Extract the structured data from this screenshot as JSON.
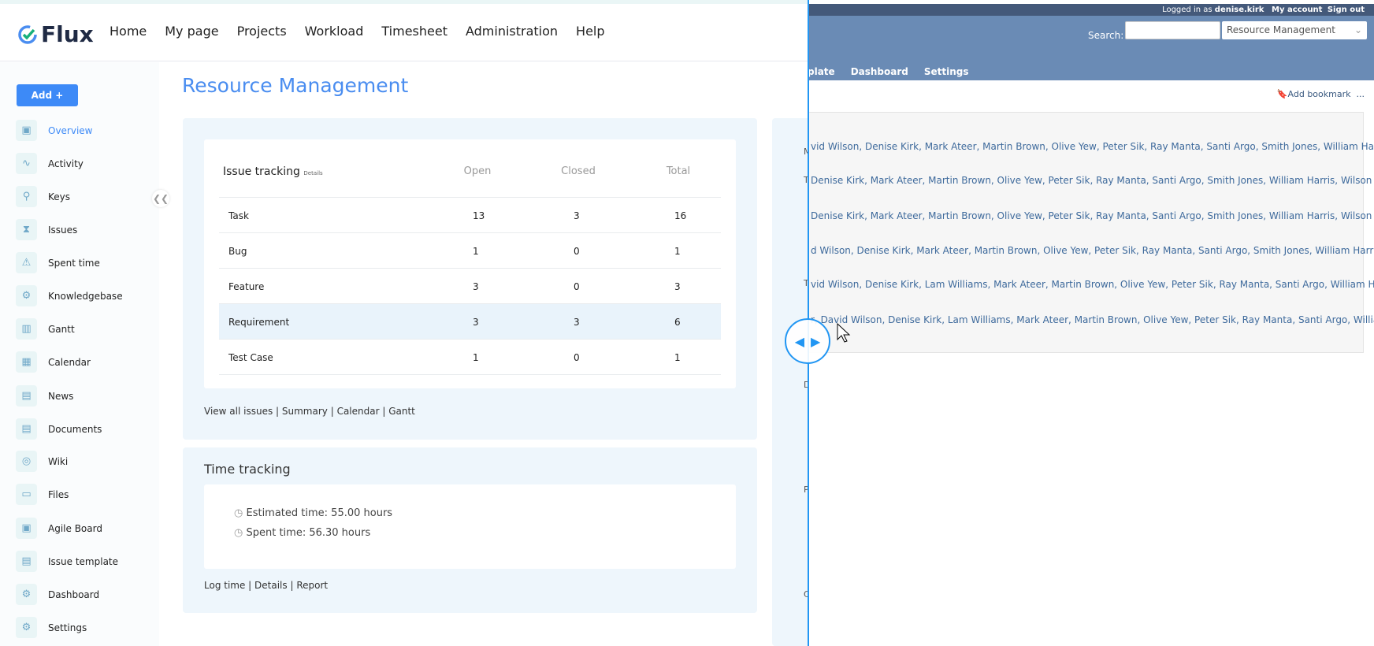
{
  "brand": "Flux",
  "nav": [
    "Home",
    "My page",
    "Projects",
    "Workload",
    "Timesheet",
    "Administration",
    "Help"
  ],
  "sidebar": {
    "add_label": "Add +",
    "items": [
      {
        "label": "Overview",
        "icon": "overview-icon"
      },
      {
        "label": "Activity",
        "icon": "activity-icon"
      },
      {
        "label": "Keys",
        "icon": "keys-icon"
      },
      {
        "label": "Issues",
        "icon": "issues-icon"
      },
      {
        "label": "Spent time",
        "icon": "spent-time-icon"
      },
      {
        "label": "Knowledgebase",
        "icon": "knowledgebase-icon"
      },
      {
        "label": "Gantt",
        "icon": "gantt-icon"
      },
      {
        "label": "Calendar",
        "icon": "calendar-icon"
      },
      {
        "label": "News",
        "icon": "news-icon"
      },
      {
        "label": "Documents",
        "icon": "documents-icon"
      },
      {
        "label": "Wiki",
        "icon": "wiki-icon"
      },
      {
        "label": "Files",
        "icon": "files-icon"
      },
      {
        "label": "Agile Board",
        "icon": "agile-board-icon"
      },
      {
        "label": "Issue template",
        "icon": "issue-template-icon"
      },
      {
        "label": "Dashboard",
        "icon": "dashboard-icon"
      },
      {
        "label": "Settings",
        "icon": "settings-icon"
      }
    ]
  },
  "page_title": "Resource Management",
  "issue_tracking": {
    "title": "Issue tracking",
    "details": "Details",
    "columns": [
      "Open",
      "Closed",
      "Total"
    ],
    "rows": [
      {
        "name": "Task",
        "open": "13",
        "closed": "3",
        "total": "16"
      },
      {
        "name": "Bug",
        "open": "1",
        "closed": "0",
        "total": "1"
      },
      {
        "name": "Feature",
        "open": "3",
        "closed": "0",
        "total": "3"
      },
      {
        "name": "Requirement",
        "open": "3",
        "closed": "3",
        "total": "6"
      },
      {
        "name": "Test Case",
        "open": "1",
        "closed": "0",
        "total": "1"
      }
    ],
    "links": [
      "View all issues",
      "Summary",
      "Calendar",
      "Gantt"
    ]
  },
  "time_tracking": {
    "title": "Time tracking",
    "estimated": "Estimated time: 55.00 hours",
    "spent": "Spent time: 56.30 hours",
    "links": [
      "Log time",
      "Details",
      "Report"
    ]
  },
  "right": {
    "logged_in_as": "Logged in as",
    "user": "denise.kirk",
    "my_account": "My account",
    "sign_out": "Sign out",
    "search_label": "Search:",
    "project_select": "Resource Management",
    "tabs": [
      "plate",
      "Dashboard",
      "Settings"
    ],
    "add_bookmark": "Add bookmark",
    "more": "...",
    "letters": [
      "M",
      "T",
      "T",
      "D",
      "P",
      "C"
    ],
    "lines": [
      "vid Wilson, Denise Kirk, Mark Ateer, Martin Brown, Olive Yew, Peter Sik, Ray Manta, Santi Argo, Smith Jones, William Harris,",
      "Denise Kirk, Mark Ateer, Martin Brown, Olive Yew, Peter Sik, Ray Manta, Santi Argo, Smith Jones, William Harris, Wilson",
      "Denise Kirk, Mark Ateer, Martin Brown, Olive Yew, Peter Sik, Ray Manta, Santi Argo, Smith Jones, William Harris, Wilson",
      "d Wilson, Denise Kirk, Mark Ateer, Martin Brown, Olive Yew, Peter Sik, Ray Manta, Santi Argo, Smith Jones, William Harris,",
      "vid Wilson, Denise Kirk, Lam Williams, Mark Ateer, Martin Brown, Olive Yew, Peter Sik, Ray Manta, Santi Argo, William Harris,",
      "r, David Wilson, Denise Kirk, Lam Williams, Mark Ateer, Martin Brown, Olive Yew, Peter Sik, Ray Manta, Santi Argo, William"
    ]
  },
  "colors": {
    "accent": "#3d8af7",
    "divider": "#2196f3",
    "header": "#6a8bb5",
    "topbar": "#44597a"
  }
}
